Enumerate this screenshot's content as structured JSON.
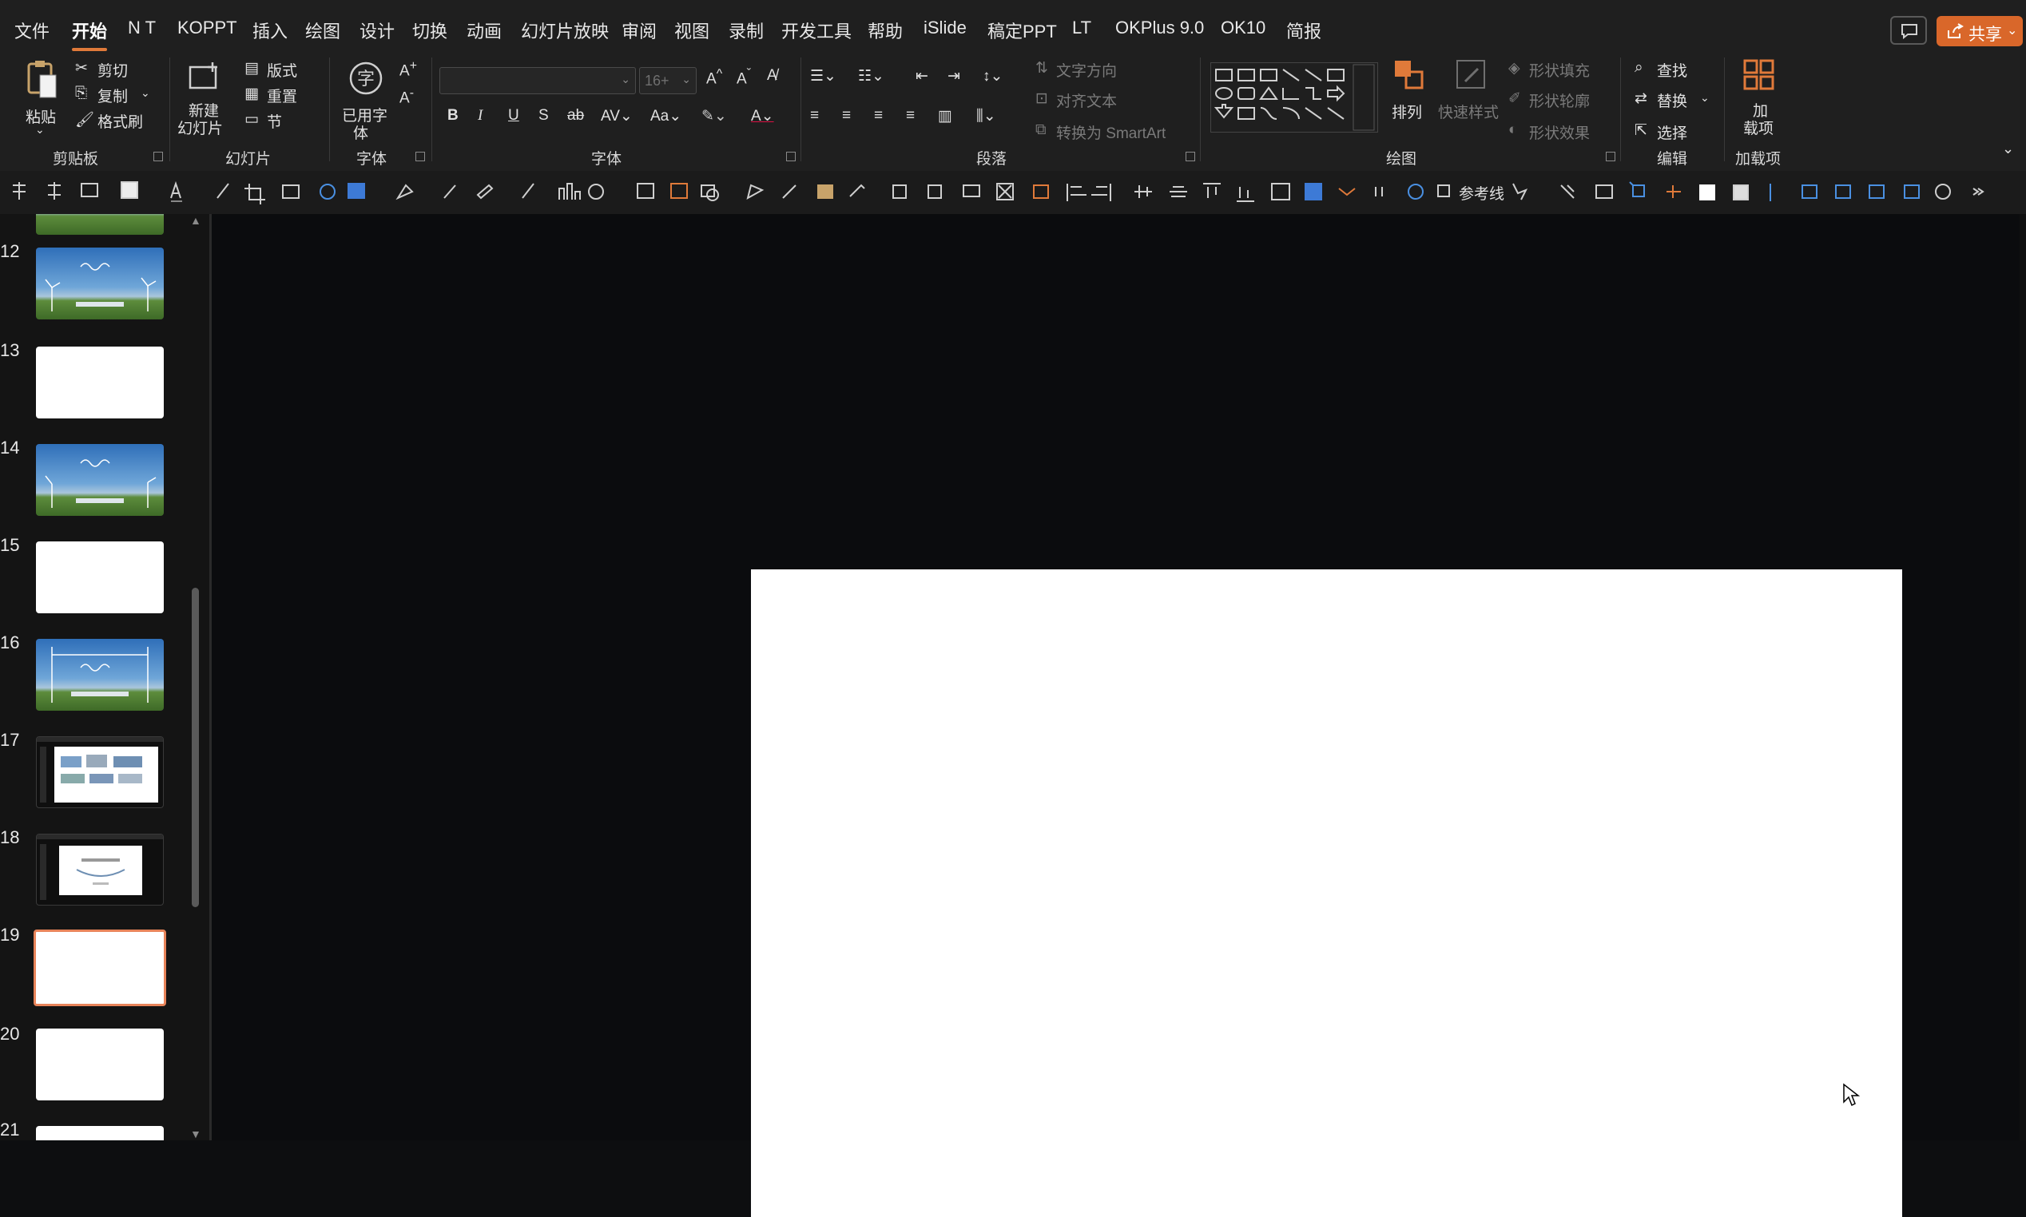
{
  "menubar": {
    "tabs": [
      {
        "label": "文件"
      },
      {
        "label": "开始",
        "active": true
      },
      {
        "label": "N T"
      },
      {
        "label": "KOPPT"
      },
      {
        "label": "插入"
      },
      {
        "label": "绘图"
      },
      {
        "label": "设计"
      },
      {
        "label": "切换"
      },
      {
        "label": "动画"
      },
      {
        "label": "幻灯片放映"
      },
      {
        "label": "审阅"
      },
      {
        "label": "视图"
      },
      {
        "label": "录制"
      },
      {
        "label": "开发工具"
      },
      {
        "label": "帮助"
      },
      {
        "label": "iSlide"
      },
      {
        "label": "稿定PPT"
      },
      {
        "label": "LT"
      },
      {
        "label": "OKPlus 9.0"
      },
      {
        "label": "OK10"
      },
      {
        "label": "简报"
      }
    ],
    "share_label": "共享",
    "comment_icon": "comment-icon"
  },
  "ribbon": {
    "clipboard": {
      "paste": "粘贴",
      "cut": "剪切",
      "copy": "复制",
      "format_painter": "格式刷",
      "group": "剪贴板"
    },
    "slides": {
      "new_slide_line1": "新建",
      "new_slide_line2": "幻灯片",
      "layout": "版式",
      "reset": "重置",
      "section": "节",
      "group": "幻灯片"
    },
    "used_font": {
      "line1": "已用字",
      "line2": "体",
      "group": "字体",
      "glyph": "字"
    },
    "font": {
      "name_value": "",
      "size_value": "16+",
      "group": "字体"
    },
    "paragraph": {
      "text_direction": "文字方向",
      "align_text": "对齐文本",
      "smartart": "转换为 SmartArt",
      "group": "段落"
    },
    "drawing": {
      "arrange": "排列",
      "quick_styles": "快速样式",
      "shape_fill": "形状填充",
      "shape_outline": "形状轮廓",
      "shape_effects": "形状效果",
      "group": "绘图"
    },
    "editing": {
      "find": "查找",
      "replace": "替换",
      "select": "选择",
      "group": "编辑"
    },
    "addins": {
      "line1": "加",
      "line2": "载项",
      "group": "加载项"
    }
  },
  "qat": {
    "guides_label": "参考线"
  },
  "slides_panel": {
    "items": [
      {
        "num": "12",
        "kind": "scenic"
      },
      {
        "num": "13",
        "kind": "blank"
      },
      {
        "num": "14",
        "kind": "scenic"
      },
      {
        "num": "15",
        "kind": "blank"
      },
      {
        "num": "16",
        "kind": "scenic"
      },
      {
        "num": "17",
        "kind": "screenshot"
      },
      {
        "num": "18",
        "kind": "screenshot"
      },
      {
        "num": "19",
        "kind": "blank",
        "selected": true
      },
      {
        "num": "20",
        "kind": "blank"
      },
      {
        "num": "21",
        "kind": "blank"
      }
    ]
  },
  "colors": {
    "accent": "#d9672a",
    "selected_border": "#e8845a",
    "slide_bg": "#ffffff",
    "canvas_bg": "#0b0c0e"
  }
}
